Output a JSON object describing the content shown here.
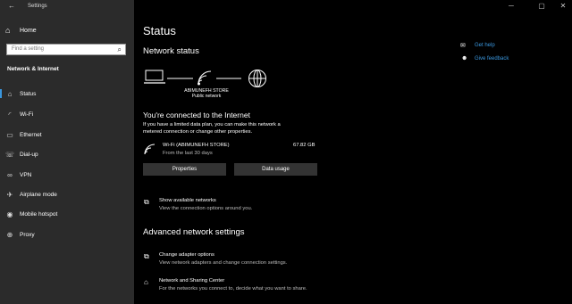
{
  "app": {
    "title": "Settings",
    "back_icon": "back-arrow-icon"
  },
  "sidebar": {
    "home_label": "Home",
    "search_placeholder": "Find a setting",
    "section_title": "Network & Internet",
    "items": [
      {
        "label": "Status",
        "icon": "home-globe-icon",
        "selected": true
      },
      {
        "label": "Wi-Fi",
        "icon": "wifi-icon"
      },
      {
        "label": "Ethernet",
        "icon": "ethernet-icon"
      },
      {
        "label": "Dial-up",
        "icon": "phone-icon"
      },
      {
        "label": "VPN",
        "icon": "vpn-icon"
      },
      {
        "label": "Airplane mode",
        "icon": "airplane-icon"
      },
      {
        "label": "Mobile hotspot",
        "icon": "hotspot-icon"
      },
      {
        "label": "Proxy",
        "icon": "globe-icon"
      }
    ]
  },
  "main": {
    "title": "Status",
    "network_status_heading": "Network status",
    "network_name": "ABIMUNEFH STORE",
    "network_type": "Public network",
    "connected_heading": "You're connected to the Internet",
    "connected_desc_1": "If you have a limited data plan, you can make this network a",
    "connected_desc_2": "metered connection or change other properties.",
    "connection": {
      "name": "Wi-Fi (ABIMUNEFH STORE)",
      "period": "From the last 30 days",
      "usage": "67.82 GB"
    },
    "properties_button": "Properties",
    "data_usage_button": "Data usage",
    "show_networks_title": "Show available networks",
    "show_networks_desc": "View the connection options around you.",
    "advanced_heading": "Advanced network settings",
    "adapter_title": "Change adapter options",
    "adapter_desc": "View network adapters and change connection settings.",
    "sharing_title": "Network and Sharing Center",
    "sharing_desc": "For the networks you connect to, decide what you want to share."
  },
  "right_links": {
    "help": "Get help",
    "feedback": "Give feedback"
  },
  "colors": {
    "accent": "#3a96dd",
    "sidebar_bg": "#2b2b2b",
    "main_bg": "#000000",
    "button_bg": "#333333"
  }
}
